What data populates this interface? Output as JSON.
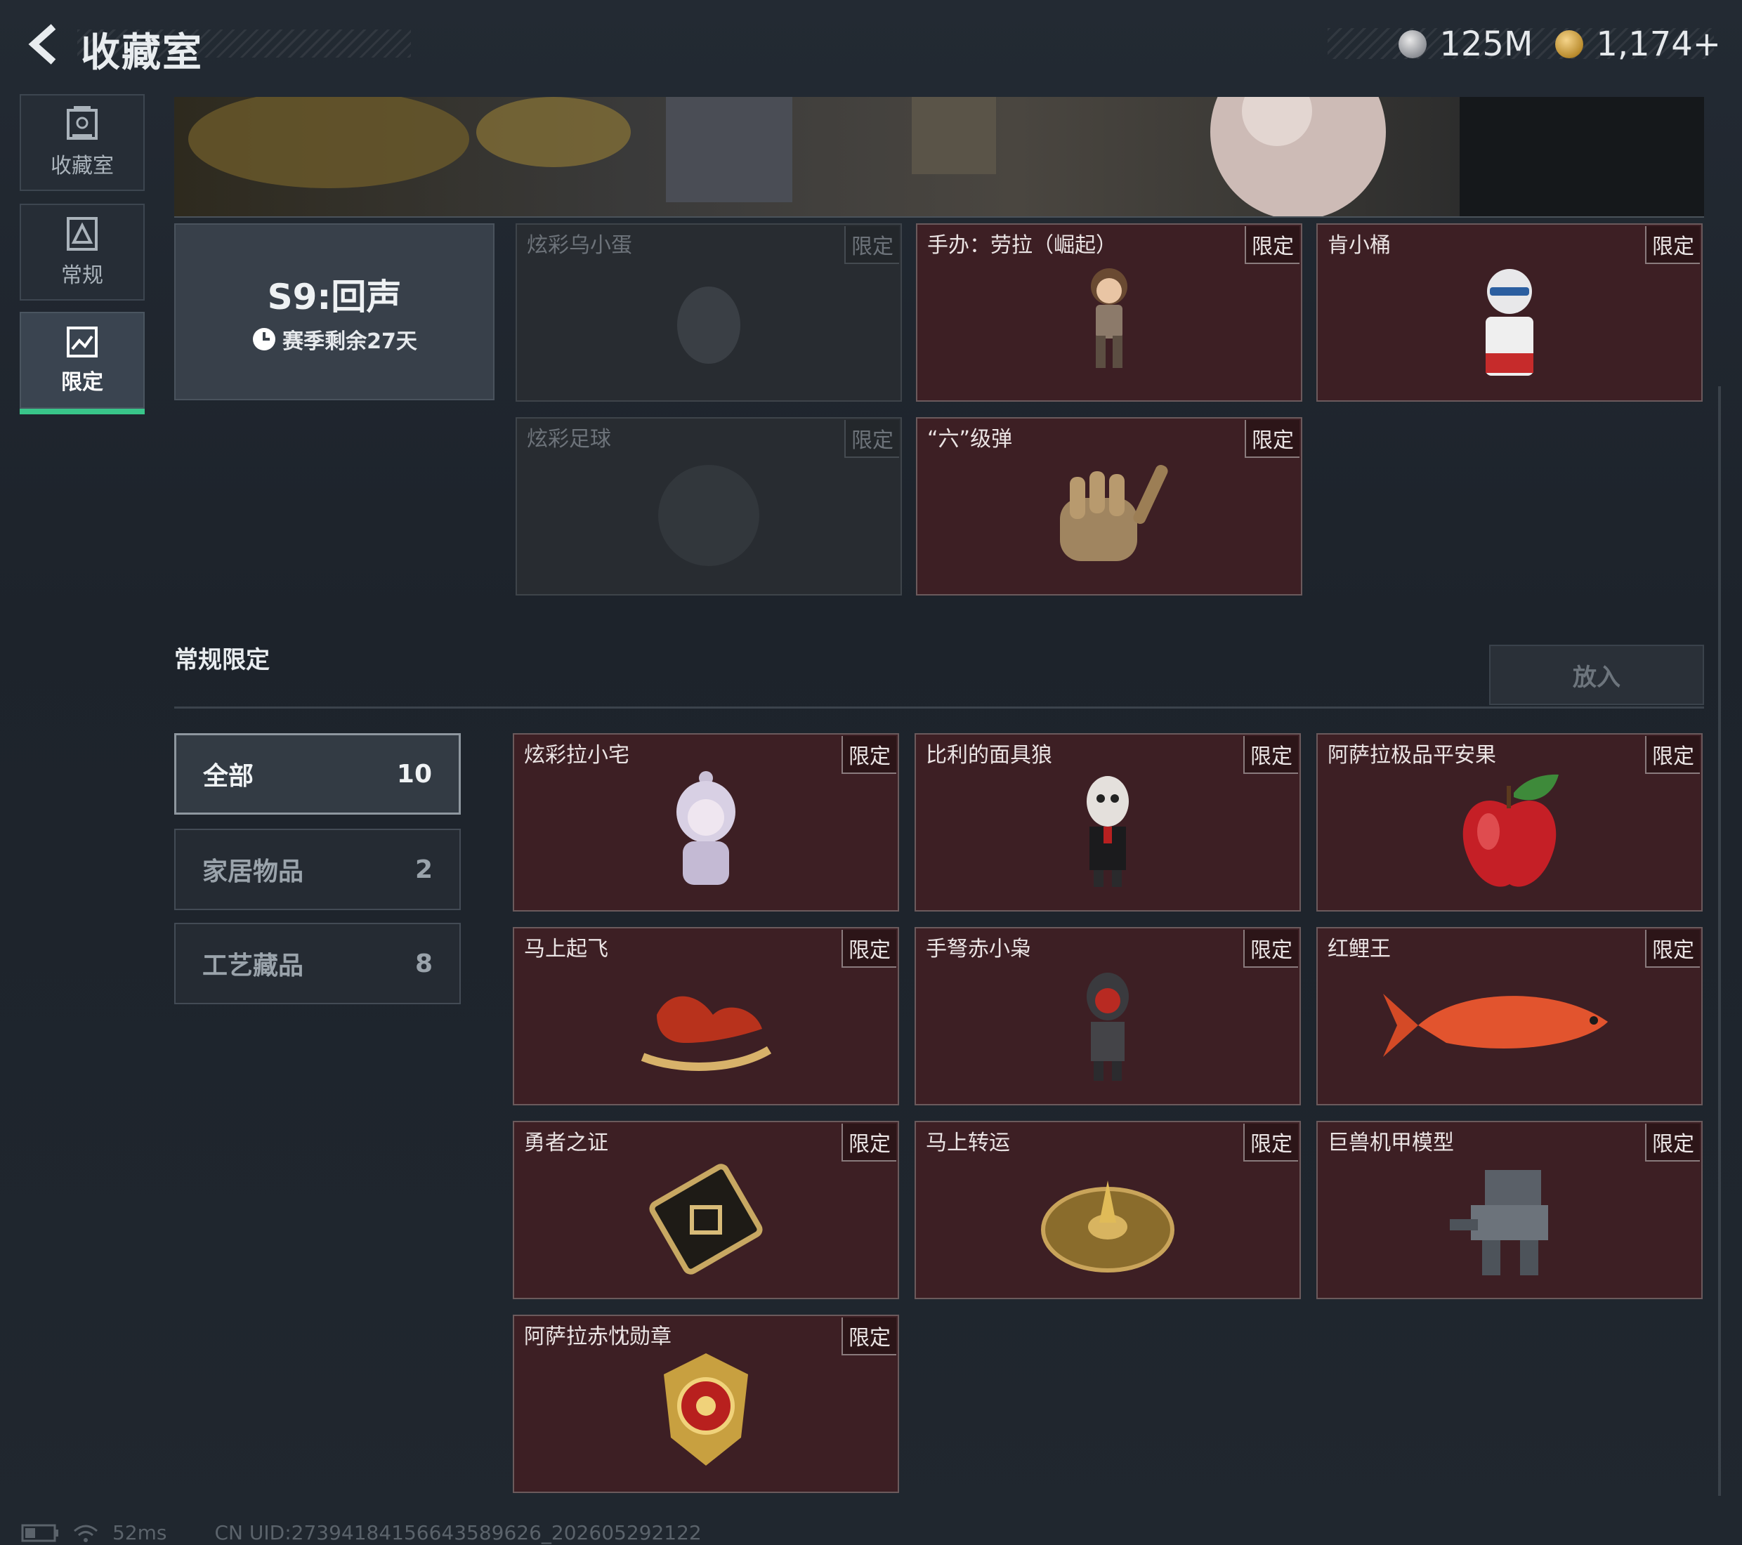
{
  "header": {
    "title": "收藏室",
    "currency_a": "125M",
    "currency_b": "1,174+"
  },
  "sidebar": {
    "items": [
      {
        "label": "收藏室"
      },
      {
        "label": "常规"
      },
      {
        "label": "限定"
      }
    ]
  },
  "season": {
    "title": "S9:回声",
    "remaining": "赛季剩余27天"
  },
  "season_items": [
    {
      "name": "炫彩乌小蛋",
      "tag": "限定",
      "locked": true
    },
    {
      "name": "手办：劳拉（崛起）",
      "tag": "限定",
      "locked": false
    },
    {
      "name": "肯小桶",
      "tag": "限定",
      "locked": false
    },
    {
      "name": "炫彩足球",
      "tag": "限定",
      "locked": true
    },
    {
      "name": "“六”级弹",
      "tag": "限定",
      "locked": false
    }
  ],
  "section": {
    "title": "常规限定",
    "put_label": "放入"
  },
  "filters": [
    {
      "label": "全部",
      "count": "10"
    },
    {
      "label": "家居物品",
      "count": "2"
    },
    {
      "label": "工艺藏品",
      "count": "8"
    }
  ],
  "items": [
    {
      "name": "炫彩拉小宅",
      "tag": "限定"
    },
    {
      "name": "比利的面具狼",
      "tag": "限定"
    },
    {
      "name": "阿萨拉极品平安果",
      "tag": "限定"
    },
    {
      "name": "马上起飞",
      "tag": "限定"
    },
    {
      "name": "手弩赤小枭",
      "tag": "限定"
    },
    {
      "name": "红鲤王",
      "tag": "限定"
    },
    {
      "name": "勇者之证",
      "tag": "限定"
    },
    {
      "name": "马上转运",
      "tag": "限定"
    },
    {
      "name": "巨兽机甲模型",
      "tag": "限定"
    },
    {
      "name": "阿萨拉赤忱勋章",
      "tag": "限定"
    }
  ],
  "status": {
    "ping": "52ms",
    "uid": "CN UID:273941841566435896​26_202605292122"
  },
  "colors": {
    "accent": "#39c58a",
    "card_bg": "#3d1f24",
    "locked_bg": "#282c31"
  }
}
